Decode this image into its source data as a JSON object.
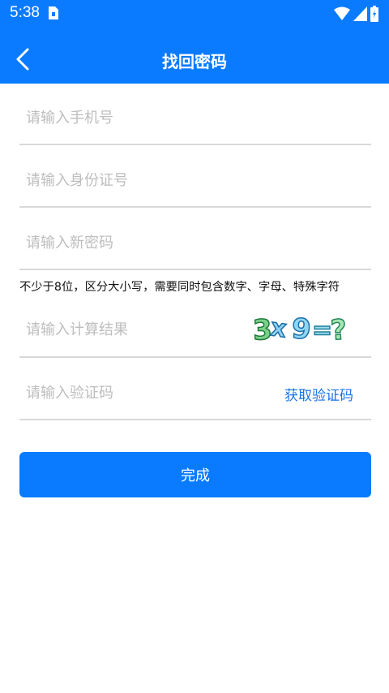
{
  "status_bar": {
    "time": "5:38"
  },
  "header": {
    "title": "找回密码",
    "back_icon": "chevron-left-icon",
    "background": "#0a7bff"
  },
  "form": {
    "phone_placeholder": "请输入手机号",
    "id_placeholder": "请输入身份证号",
    "password_placeholder": "请输入新密码",
    "password_hint": "不少于8位，区分大小写，需要同时包含数字、字母、特殊字符",
    "calc_placeholder": "请输入计算结果",
    "code_placeholder": "请输入验证码",
    "get_code_label": "获取验证码",
    "submit_label": "完成"
  },
  "captcha": {
    "chars": [
      "3",
      "x",
      "9",
      "=",
      "?"
    ]
  }
}
